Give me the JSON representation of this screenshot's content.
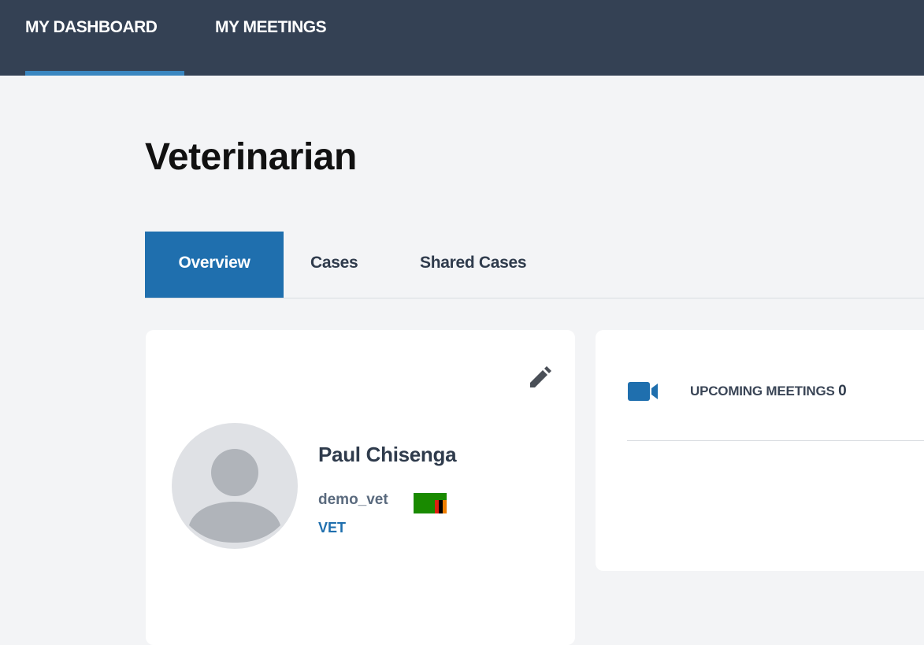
{
  "nav": {
    "items": [
      {
        "label": "MY DASHBOARD",
        "active": true
      },
      {
        "label": "MY MEETINGS",
        "active": false
      }
    ]
  },
  "page": {
    "title": "Veterinarian"
  },
  "tabs": [
    {
      "label": "Overview",
      "active": true
    },
    {
      "label": "Cases",
      "active": false
    },
    {
      "label": "Shared Cases",
      "active": false
    }
  ],
  "profile": {
    "name": "Paul Chisenga",
    "username": "demo_vet",
    "role": "VET",
    "edit_icon": "pencil-icon",
    "avatar_icon": "user-silhouette-icon",
    "flag_icon": "zambia-flag-icon"
  },
  "meetings": {
    "icon": "video-camera-icon",
    "label": "UPCOMING MEETINGS",
    "count": "0"
  },
  "colors": {
    "topbar": "#344154",
    "nav_underline": "#3a86c0",
    "primary": "#1f6fae",
    "background": "#f3f4f6",
    "card": "#ffffff"
  }
}
